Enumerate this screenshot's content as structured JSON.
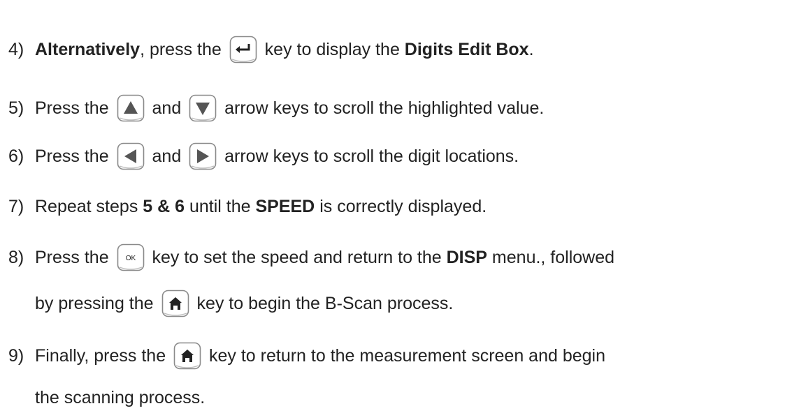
{
  "steps": [
    {
      "num": "4)",
      "parts": [
        {
          "t": "text",
          "v": "Alternatively",
          "bold": true
        },
        {
          "t": "text",
          "v": ", press the "
        },
        {
          "t": "key",
          "icon": "enter-icon"
        },
        {
          "t": "text",
          "v": " key to display the "
        },
        {
          "t": "text",
          "v": "Digits Edit Box",
          "bold": true
        },
        {
          "t": "text",
          "v": "."
        }
      ]
    },
    {
      "num": "5)",
      "parts": [
        {
          "t": "text",
          "v": "Press the "
        },
        {
          "t": "key",
          "icon": "up-arrow-icon"
        },
        {
          "t": "text",
          "v": " and "
        },
        {
          "t": "key",
          "icon": "down-arrow-icon"
        },
        {
          "t": "text",
          "v": " arrow keys to scroll the highlighted value."
        }
      ]
    },
    {
      "num": "6)",
      "parts": [
        {
          "t": "text",
          "v": "Press the "
        },
        {
          "t": "key",
          "icon": "left-arrow-icon"
        },
        {
          "t": "text",
          "v": " and "
        },
        {
          "t": "key",
          "icon": "right-arrow-icon"
        },
        {
          "t": "text",
          "v": " arrow keys to scroll the digit locations."
        }
      ]
    },
    {
      "num": "7)",
      "parts": [
        {
          "t": "text",
          "v": "Repeat steps "
        },
        {
          "t": "text",
          "v": "5 & 6",
          "bold": true
        },
        {
          "t": "text",
          "v": " until the "
        },
        {
          "t": "text",
          "v": "SPEED",
          "bold": true
        },
        {
          "t": "text",
          "v": " is correctly displayed."
        }
      ]
    },
    {
      "num": "8)",
      "parts": [
        {
          "t": "text",
          "v": "Press the "
        },
        {
          "t": "key",
          "icon": "ok-key-icon",
          "label": "OK"
        },
        {
          "t": "text",
          "v": " key to set the speed and return to the "
        },
        {
          "t": "text",
          "v": "DISP",
          "bold": true
        },
        {
          "t": "text",
          "v": " menu., followed"
        }
      ],
      "cont": [
        {
          "t": "text",
          "v": "by pressing the "
        },
        {
          "t": "key",
          "icon": "home-icon"
        },
        {
          "t": "text",
          "v": " key to begin the B-Scan process."
        }
      ]
    },
    {
      "num": "9)",
      "parts": [
        {
          "t": "text",
          "v": "Finally, press the "
        },
        {
          "t": "key",
          "icon": "home-icon"
        },
        {
          "t": "text",
          "v": " key to return to the measurement screen and begin"
        }
      ],
      "cont": [
        {
          "t": "text",
          "v": "the scanning process."
        }
      ]
    }
  ]
}
